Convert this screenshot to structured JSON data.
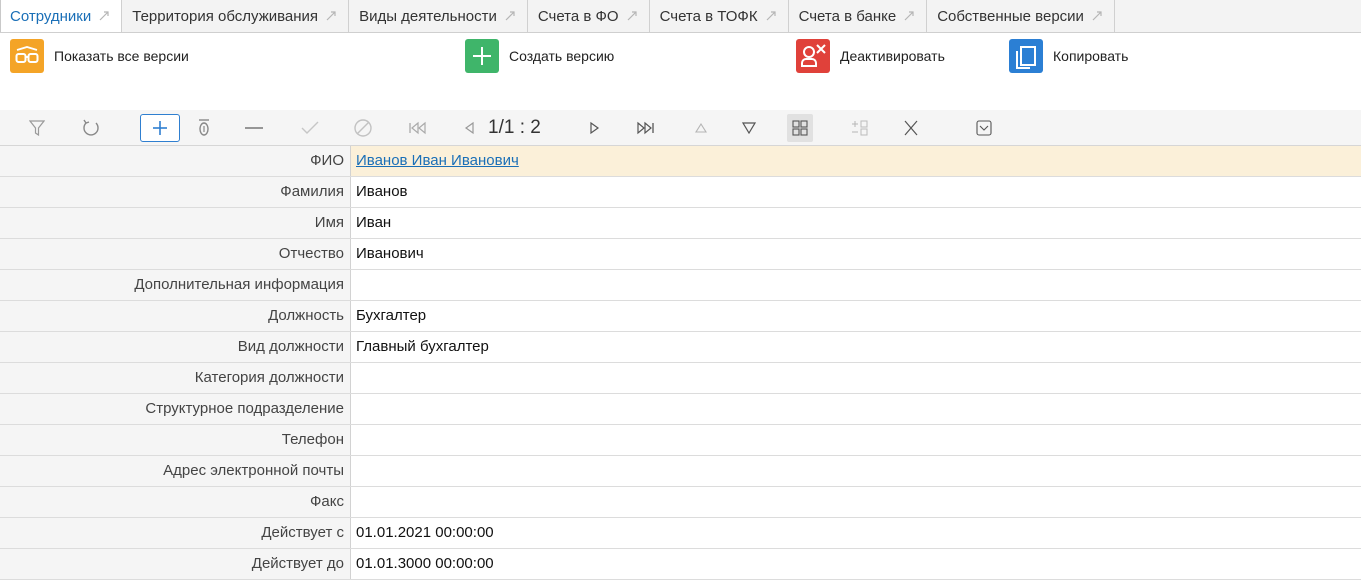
{
  "tabs": [
    {
      "label": "Сотрудники",
      "active": true
    },
    {
      "label": "Территория обслуживания"
    },
    {
      "label": "Виды деятельности"
    },
    {
      "label": "Счета в ФО"
    },
    {
      "label": "Счета в ТОФК"
    },
    {
      "label": "Счета в банке"
    },
    {
      "label": "Собственные версии"
    }
  ],
  "actions": {
    "show_all": "Показать все версии",
    "create": "Создать версию",
    "deactivate": "Деактивировать",
    "copy": "Копировать"
  },
  "toolbar": {
    "pager": "1/1 : 2"
  },
  "form": {
    "fio": {
      "label": "ФИО",
      "value": "Иванов Иван Иванович"
    },
    "last_name": {
      "label": "Фамилия",
      "value": "Иванов"
    },
    "first_name": {
      "label": "Имя",
      "value": "Иван"
    },
    "patronymic": {
      "label": "Отчество",
      "value": "Иванович"
    },
    "extra_info": {
      "label": "Дополнительная информация",
      "value": ""
    },
    "position": {
      "label": "Должность",
      "value": "Бухгалтер"
    },
    "position_kind": {
      "label": "Вид должности",
      "value": "Главный бухгалтер"
    },
    "position_category": {
      "label": "Категория должности",
      "value": ""
    },
    "department": {
      "label": "Структурное подразделение",
      "value": ""
    },
    "phone": {
      "label": "Телефон",
      "value": ""
    },
    "email": {
      "label": "Адрес электронной почты",
      "value": ""
    },
    "fax": {
      "label": "Факс",
      "value": ""
    },
    "valid_from": {
      "label": "Действует с",
      "value": "01.01.2021 00:00:00"
    },
    "valid_to": {
      "label": "Действует до",
      "value": "01.01.3000 00:00:00"
    }
  },
  "colors": {
    "accent": "#1a6fb7",
    "show_all_icon": "#f4a427",
    "create_icon": "#3fb56a",
    "deactivate_icon": "#e0413a",
    "copy_icon": "#2b7fd4",
    "highlight_row": "#fbf0d9"
  },
  "icons": {
    "show_all": "glasses-icon",
    "create": "plus-icon",
    "deactivate": "user-remove-icon",
    "copy": "copy-icon"
  }
}
